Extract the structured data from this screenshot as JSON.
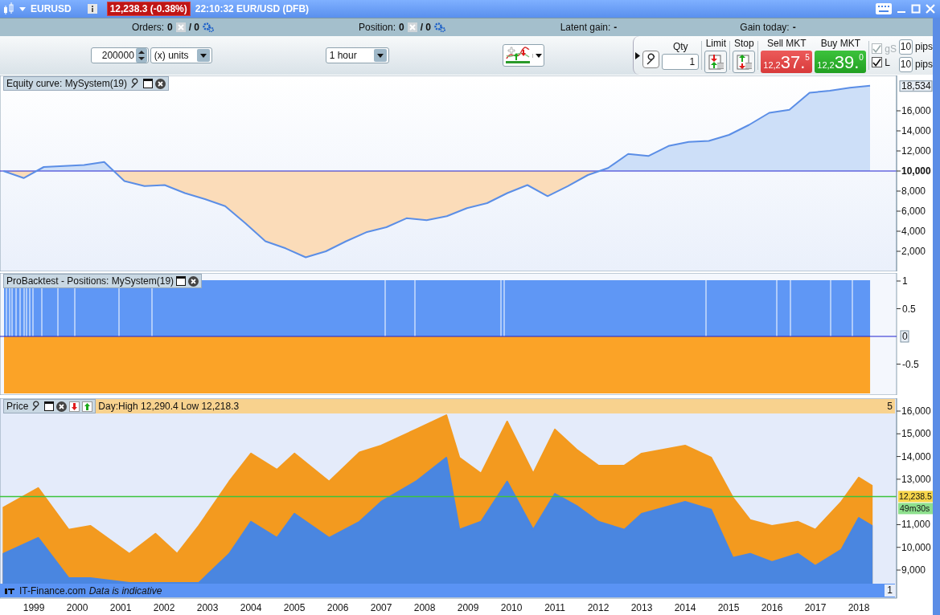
{
  "window": {
    "symbol": "EURUSD",
    "price_badge": "12,238.3 (-0.38%)",
    "time_instrument": "22:10:32 EUR/USD (DFB)"
  },
  "info_bar": [
    {
      "kind": "count",
      "label": "Orders:",
      "value": "0",
      "total": "/ 0"
    },
    {
      "kind": "count",
      "label": "Position:",
      "value": "0",
      "total": "/ 0"
    },
    {
      "kind": "text",
      "label": "Latent gain:",
      "value": "-"
    },
    {
      "kind": "text",
      "label": "Gain today:",
      "value": "-"
    }
  ],
  "toolbar": {
    "quantity": "200000",
    "unit": "(x) units",
    "timeframe": "1 hour"
  },
  "trade_panel": {
    "qty_label": "Qty",
    "qty": "1",
    "limit_label": "Limit",
    "stop_label": "Stop",
    "sell": {
      "label": "Sell MKT",
      "prefix": "12,2",
      "big": "37.",
      "sup": "5"
    },
    "buy": {
      "label": "Buy MKT",
      "prefix": "12,2",
      "big": "39.",
      "sup": "0"
    },
    "options": [
      {
        "label": "gS",
        "checked": true,
        "disabled": true,
        "pips": "10",
        "unit": "pips"
      },
      {
        "label": "L",
        "checked": true,
        "disabled": false,
        "pips": "10",
        "unit": "pips"
      }
    ]
  },
  "equity_panel": {
    "title": "Equity curve: MySystem(19)",
    "last_value": "18,534",
    "chart_data": {
      "type": "line",
      "ylim": [
        0,
        19520
      ],
      "categories": [
        null,
        null,
        null,
        null,
        null,
        null,
        null,
        null,
        null,
        null,
        null,
        null,
        null,
        null,
        null,
        null,
        null,
        null,
        null,
        null,
        null,
        null,
        null,
        null,
        null,
        null,
        null,
        null,
        null,
        null,
        null,
        null,
        null,
        null,
        null,
        null,
        null,
        null,
        null,
        null,
        null,
        null,
        null,
        null
      ],
      "series": [
        {
          "color": "#5b8ee6",
          "values": [
            10000,
            9300,
            10400,
            10500,
            10600,
            10900,
            9000,
            8500,
            8600,
            7800,
            7200,
            6500,
            4800,
            3000,
            2300,
            1400,
            2000,
            3000,
            3900,
            4400,
            5300,
            5100,
            5500,
            6300,
            6800,
            7800,
            8600,
            7500,
            8500,
            9600,
            10300,
            11700,
            11500,
            12500,
            12900,
            13000,
            13600,
            14600,
            15800,
            16100,
            17800,
            18000,
            18300,
            18500
          ]
        }
      ],
      "yticks": [
        {
          "value": 2000,
          "label": "2,000"
        },
        {
          "value": 4000,
          "label": "4,000"
        },
        {
          "value": 6000,
          "label": "6,000"
        },
        {
          "value": 8000,
          "label": "8,000"
        },
        {
          "value": 10000,
          "label": "10,000"
        },
        {
          "value": 12000,
          "label": "12,000"
        },
        {
          "value": 14000,
          "label": "14,000"
        },
        {
          "value": 16000,
          "label": "16,000"
        }
      ],
      "ref_lines": [
        {
          "axis": "y",
          "value": 10000
        }
      ]
    }
  },
  "positions_panel": {
    "title": "ProBacktest - Positions: MySystem(19)",
    "axis_labels": [
      {
        "kind": "tick",
        "label": "1"
      },
      {
        "kind": "tick",
        "label": "0.5"
      },
      {
        "kind": "badge",
        "label": "0"
      },
      {
        "kind": "tick",
        "label": "-0.5"
      }
    ]
  },
  "price_panel": {
    "title": "Price",
    "day_range": "Day:High 12,290.4 Low 12,218.3",
    "count": "5",
    "countdown": "49m30s",
    "chart_data": {
      "type": "area",
      "xlim": [
        1998.22,
        2018.87
      ],
      "ylim": [
        7764,
        16566
      ],
      "x": [
        1998.3,
        1999.1,
        1999.8,
        2000.3,
        2001.2,
        2001.8,
        2002.3,
        2002.8,
        2003.5,
        2004,
        2004.6,
        2005,
        2005.8,
        2006.5,
        2007,
        2007.8,
        2008.5,
        2008.8,
        2009.3,
        2009.9,
        2010.5,
        2011,
        2011.5,
        2012,
        2012.6,
        2013,
        2014,
        2014.6,
        2015.1,
        2015.5,
        2016,
        2016.6,
        2017,
        2017.6,
        2018,
        2018.3
      ],
      "series": [
        {
          "color": "#f39a1f",
          "values": [
            11760,
            12610,
            10780,
            10950,
            9720,
            10600,
            9720,
            10950,
            12900,
            14130,
            13420,
            14130,
            12900,
            14180,
            14480,
            15190,
            15820,
            13950,
            13250,
            15540,
            13250,
            15190,
            14300,
            13600,
            13600,
            14130,
            14480,
            13950,
            12190,
            11200,
            10950,
            11130,
            10780,
            12010,
            13070,
            12720
          ]
        },
        {
          "color": "#4a86e0",
          "values": [
            9720,
            10420,
            8650,
            8650,
            8440,
            8440,
            8440,
            8440,
            9720,
            11130,
            10420,
            11480,
            10420,
            11130,
            12010,
            12900,
            13950,
            10780,
            11130,
            12900,
            10780,
            12360,
            11830,
            11130,
            10780,
            11480,
            12010,
            11660,
            9540,
            9720,
            9360,
            9720,
            9190,
            9900,
            11300,
            10950
          ]
        }
      ],
      "xticks": [
        {
          "value": 1999,
          "label": "1999"
        },
        {
          "value": 2000,
          "label": "2000"
        },
        {
          "value": 2001,
          "label": "2001"
        },
        {
          "value": 2002,
          "label": "2002"
        },
        {
          "value": 2003,
          "label": "2003"
        },
        {
          "value": 2004,
          "label": "2004"
        },
        {
          "value": 2005,
          "label": "2005"
        },
        {
          "value": 2006,
          "label": "2006"
        },
        {
          "value": 2007,
          "label": "2007"
        },
        {
          "value": 2008,
          "label": "2008"
        },
        {
          "value": 2009,
          "label": "2009"
        },
        {
          "value": 2010,
          "label": "2010"
        },
        {
          "value": 2011,
          "label": "2011"
        },
        {
          "value": 2012,
          "label": "2012"
        },
        {
          "value": 2013,
          "label": "2013"
        },
        {
          "value": 2014,
          "label": "2014"
        },
        {
          "value": 2015,
          "label": "2015"
        },
        {
          "value": 2016,
          "label": "2016"
        },
        {
          "value": 2017,
          "label": "2017"
        },
        {
          "value": 2018,
          "label": "2018"
        }
      ],
      "yticks": [
        {
          "value": 9000,
          "label": "9,000"
        },
        {
          "value": 10000,
          "label": "10,000"
        },
        {
          "value": 11000,
          "label": "11,000"
        },
        {
          "value": 13000,
          "label": "13,000"
        },
        {
          "value": 14000,
          "label": "14,000"
        },
        {
          "value": 15000,
          "label": "15,000"
        },
        {
          "value": 16000,
          "label": "16,000"
        }
      ],
      "ref_lines": [
        {
          "axis": "y",
          "value": 12238.5,
          "label": "12,238.5"
        }
      ]
    },
    "footer": {
      "source": "IT-Finance.com",
      "note": "Data is indicative",
      "page": "1"
    }
  }
}
